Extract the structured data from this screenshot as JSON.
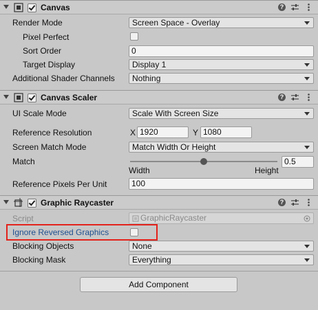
{
  "canvas": {
    "title": "Canvas",
    "rows": {
      "render_mode": {
        "label": "Render Mode",
        "value": "Screen Space - Overlay"
      },
      "pixel_perfect": {
        "label": "Pixel Perfect"
      },
      "sort_order": {
        "label": "Sort Order",
        "value": "0"
      },
      "target_display": {
        "label": "Target Display",
        "value": "Display 1"
      },
      "shader_channels": {
        "label": "Additional Shader Channels",
        "value": "Nothing"
      }
    }
  },
  "canvas_scaler": {
    "title": "Canvas Scaler",
    "rows": {
      "ui_scale_mode": {
        "label": "UI Scale Mode",
        "value": "Scale With Screen Size"
      },
      "reference_resolution": {
        "label": "Reference Resolution",
        "x_label": "X",
        "x_value": "1920",
        "y_label": "Y",
        "y_value": "1080"
      },
      "screen_match_mode": {
        "label": "Screen Match Mode",
        "value": "Match Width Or Height"
      },
      "match": {
        "label": "Match",
        "value": "0.5",
        "min_label": "Width",
        "max_label": "Height",
        "fraction": 0.5
      },
      "ref_pixels": {
        "label": "Reference Pixels Per Unit",
        "value": "100"
      }
    }
  },
  "graphic_raycaster": {
    "title": "Graphic Raycaster",
    "rows": {
      "script": {
        "label": "Script",
        "value": "GraphicRaycaster"
      },
      "ignore_reversed": {
        "label": "Ignore Reversed Graphics"
      },
      "blocking_objects": {
        "label": "Blocking Objects",
        "value": "None"
      },
      "blocking_mask": {
        "label": "Blocking Mask",
        "value": "Everything"
      }
    }
  },
  "add_component_label": "Add Component",
  "colors": {
    "highlight": "#e3221b",
    "panel": "#c8c8c8"
  }
}
